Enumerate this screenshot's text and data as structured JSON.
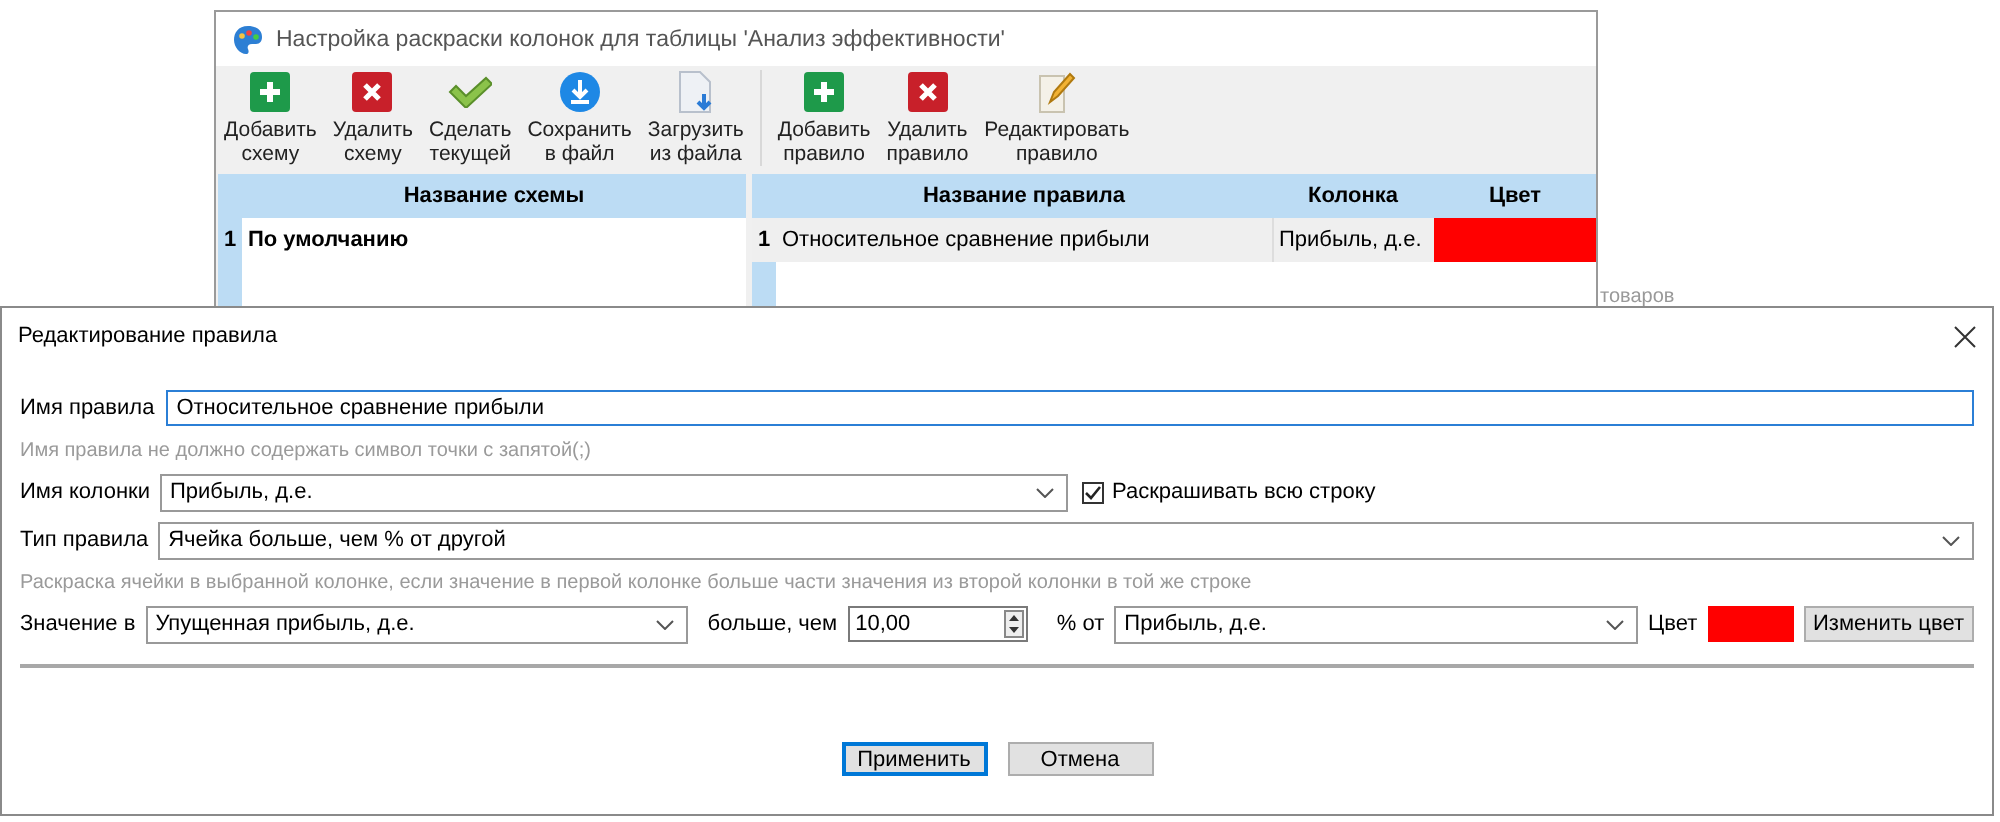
{
  "background_text": "товаров",
  "main_window": {
    "title": "Настройка раскраски колонок для таблицы 'Анализ эффективности'",
    "toolbar": [
      [
        {
          "kind": "add",
          "label": [
            "Добавить",
            "схему"
          ]
        },
        {
          "kind": "delete",
          "label": [
            "Удалить",
            "схему"
          ]
        },
        {
          "kind": "check",
          "label": [
            "Сделать",
            "текущей"
          ]
        },
        {
          "kind": "save",
          "label": [
            "Сохранить",
            "в файл"
          ]
        },
        {
          "kind": "load",
          "label": [
            "Загрузить",
            "из файла"
          ]
        }
      ],
      [
        {
          "kind": "add",
          "label": [
            "Добавить",
            "правило"
          ]
        },
        {
          "kind": "delete",
          "label": [
            "Удалить",
            "правило"
          ]
        },
        {
          "kind": "edit",
          "label": [
            "Редактировать",
            "правило"
          ]
        }
      ]
    ],
    "schemes_table": {
      "columns": [
        "Название схемы"
      ],
      "rows": [
        {
          "number": "1",
          "name": "По умолчанию",
          "current": true,
          "selected": false
        }
      ]
    },
    "rules_table": {
      "columns": [
        "Название правила",
        "Колонка",
        "Цвет"
      ],
      "rows": [
        {
          "number": "1",
          "name": "Относительное сравнение прибыли",
          "column": "Прибыль, д.е.",
          "color": "#ff0000",
          "selected": true
        }
      ]
    }
  },
  "dialog": {
    "title": "Редактирование правила",
    "rule_name": {
      "label": "Имя правила",
      "value": "Относительное сравнение прибыли",
      "focused": true
    },
    "rule_name_hint": "Имя правила не должно содержать символ точки с запятой(;)",
    "column_name": {
      "label": "Имя колонки",
      "value": "Прибыль, д.е."
    },
    "color_whole_row": {
      "label": "Раскрашивать всю строку",
      "checked": true
    },
    "rule_type": {
      "label": "Тип правила",
      "value": "Ячейка больше, чем % от другой"
    },
    "rule_type_hint": "Раскраска ячейки в выбранной колонке, если значение в первой колонке больше части значения из второй колонки в той же строке",
    "value_row": {
      "value_in_label": "Значение в",
      "value_in": "Упущенная прибыль, д.е.",
      "greater_label": "больше, чем",
      "percent": "10,00",
      "percent_of_label": "% от",
      "percent_of": "Прибыль, д.е.",
      "color_label": "Цвет",
      "color": "#ff0000",
      "change_color_button": "Изменить цвет"
    },
    "buttons": [
      {
        "label": "Применить",
        "default": true
      },
      {
        "label": "Отмена",
        "default": false
      }
    ]
  }
}
